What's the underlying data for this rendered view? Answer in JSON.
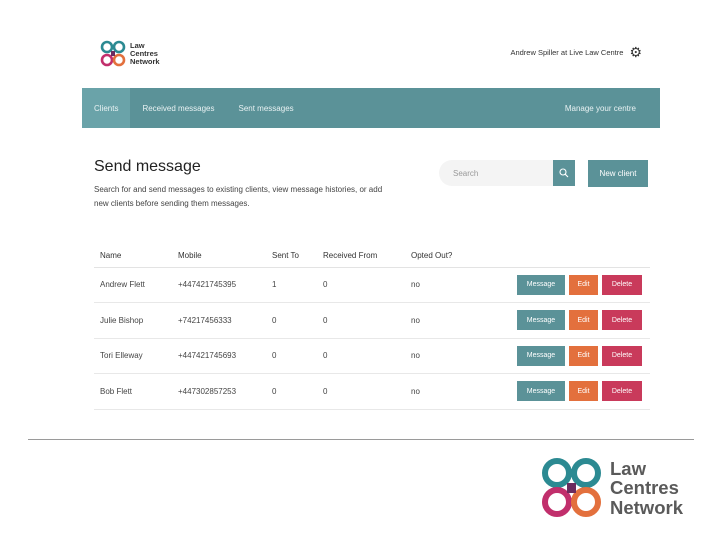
{
  "brand": {
    "logo_lines": [
      "Law",
      "Centres",
      "Network"
    ],
    "colors": {
      "teal": "#2c8a92",
      "orange": "#e3703d",
      "magenta": "#c12f6c",
      "purple": "#6b2c5f"
    }
  },
  "header": {
    "user_label": "Andrew Spiller at Live Law Centre",
    "settings_icon": "gear-icon"
  },
  "nav": {
    "tabs": [
      {
        "label": "Clients",
        "active": true
      },
      {
        "label": "Received messages"
      },
      {
        "label": "Sent messages"
      }
    ],
    "right_link": "Manage your centre",
    "color": "#5b9298"
  },
  "main": {
    "title": "Send message",
    "description": "Search for and send messages to existing clients, view message histories, or add new clients before sending them messages.",
    "search_placeholder": "Search",
    "new_client_label": "New client"
  },
  "table": {
    "columns": [
      "Name",
      "Mobile",
      "Sent To",
      "Received From",
      "Opted Out?"
    ],
    "rows": [
      {
        "name": "Andrew Flett",
        "mobile": "+447421745395",
        "sent_to": "1",
        "received_from": "0",
        "opted_out": "no"
      },
      {
        "name": "Julie Bishop",
        "mobile": "+74217456333",
        "sent_to": "0",
        "received_from": "0",
        "opted_out": "no"
      },
      {
        "name": "Tori Elleway",
        "mobile": "+447421745693",
        "sent_to": "0",
        "received_from": "0",
        "opted_out": "no"
      },
      {
        "name": "Bob Flett",
        "mobile": "+447302857253",
        "sent_to": "0",
        "received_from": "0",
        "opted_out": "no"
      }
    ],
    "actions": {
      "message": "Message",
      "edit": "Edit",
      "delete": "Delete"
    }
  }
}
